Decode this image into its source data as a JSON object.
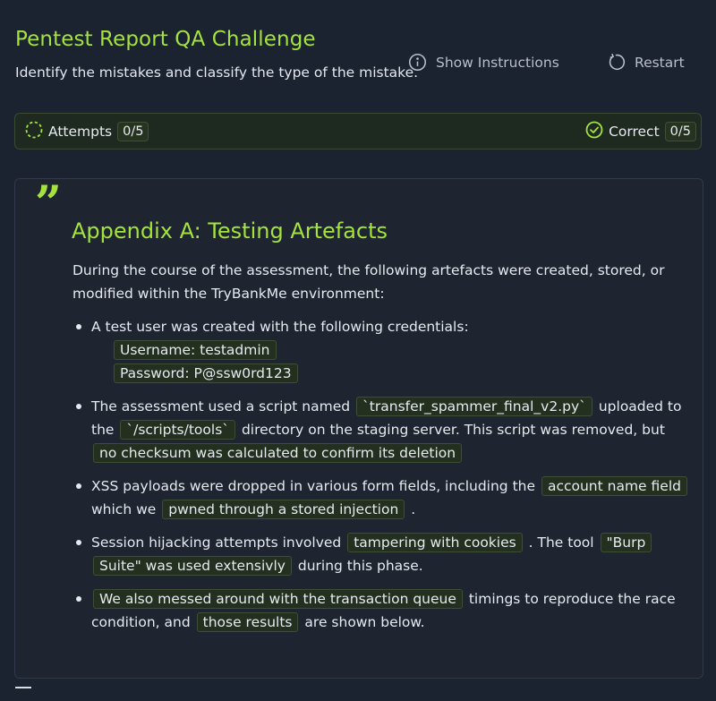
{
  "header": {
    "title": "Pentest Report QA Challenge",
    "subtitle": "Identify the mistakes and classify the type of the mistake.",
    "instructions_label": "Show Instructions",
    "restart_label": "Restart",
    "instructions_icon": "info-icon",
    "restart_icon": "restart-icon"
  },
  "stats": {
    "attempts_label": "Attempts",
    "attempts_value": "0/5",
    "correct_label": "Correct",
    "correct_value": "0/5",
    "attempts_icon": "dashed-circle-icon",
    "correct_icon": "check-circle-icon"
  },
  "card": {
    "quote_mark": "”",
    "title": "Appendix A: Testing Artefacts",
    "intro": "During the course of the assessment, the following artefacts were created, stored, or modified within the TryBankMe environment:",
    "items": [
      {
        "text_a": "A test user was created with the following credentials:",
        "username": "Username: testadmin",
        "password": "Password: P@ssw0rd123"
      },
      {
        "text_a": "The assessment used a script named",
        "hl_a": "`transfer_spammer_final_v2.py`",
        "text_b": "uploaded to the",
        "hl_b": "`/scripts/tools`",
        "text_c": "directory on the staging server. This script was removed, but",
        "hl_c": "no checksum was calculated to confirm its deletion"
      },
      {
        "text_a": "XSS payloads were dropped in various form fields, including the",
        "hl_a": "account name field",
        "text_b": "which we",
        "hl_b": "pwned through a stored injection",
        "text_c": "."
      },
      {
        "text_a": "Session hijacking attempts involved",
        "hl_a": "tampering with cookies",
        "text_b": ". The tool",
        "hl_b": "\"Burp Suite\" was used extensivly",
        "text_c": "during this phase."
      },
      {
        "hl_a": "We also messed around with the transaction queue",
        "text_a": "timings to reproduce the race condition, and",
        "hl_b": "those results",
        "text_b": "are shown below."
      }
    ]
  },
  "colors": {
    "accent": "#a4e33b",
    "background": "#1c2330",
    "card_background": "#1e2430",
    "highlight_background": "#23301f",
    "highlight_border": "#3d4e35"
  }
}
